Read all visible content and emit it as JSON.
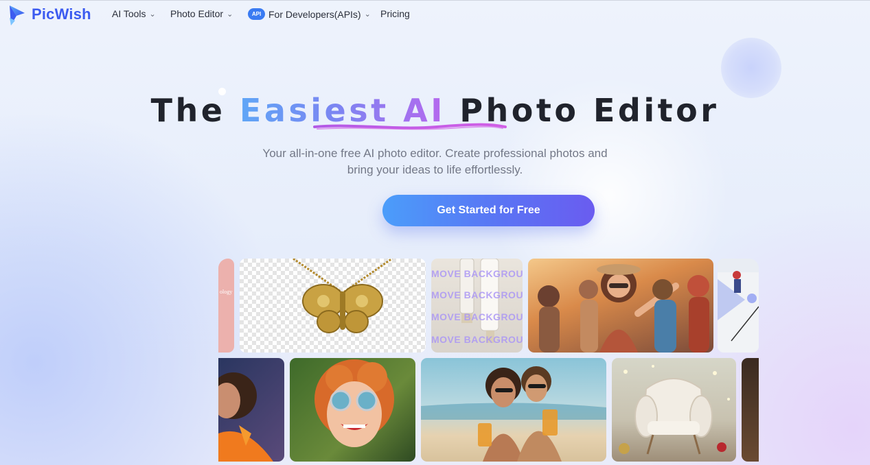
{
  "brand": {
    "name": "PicWish",
    "color": "#3c5bf0"
  },
  "nav": {
    "items": [
      {
        "label": "AI Tools",
        "has_dropdown": true
      },
      {
        "label": "Photo Editor",
        "has_dropdown": true
      },
      {
        "label": "For Developers(APIs)",
        "has_dropdown": true,
        "badge": "API"
      },
      {
        "label": "Pricing",
        "has_dropdown": false
      }
    ]
  },
  "hero": {
    "title_prefix": "The ",
    "title_highlight": "Easiest AI",
    "title_suffix": " Photo Editor",
    "subtitle_line1": "Your all-in-one free AI photo editor. Create professional photos and",
    "subtitle_line2": "bring your ideas to life effortlessly.",
    "cta_label": "Get Started for Free"
  },
  "gallery": {
    "pink_card_text": "ology",
    "watermark_rows": [
      "MOVE  BACKGROU",
      "MOVE  BACKGROU",
      "MOVE  BACKGROU",
      "MOVE  BACKGROU"
    ]
  },
  "colors": {
    "accent_blue": "#4b9dfa",
    "accent_purple": "#6a5cf0",
    "highlight_gradient_start": "#5fa6f6",
    "highlight_gradient_end": "#b668ee",
    "underline": "#c65ce8"
  }
}
